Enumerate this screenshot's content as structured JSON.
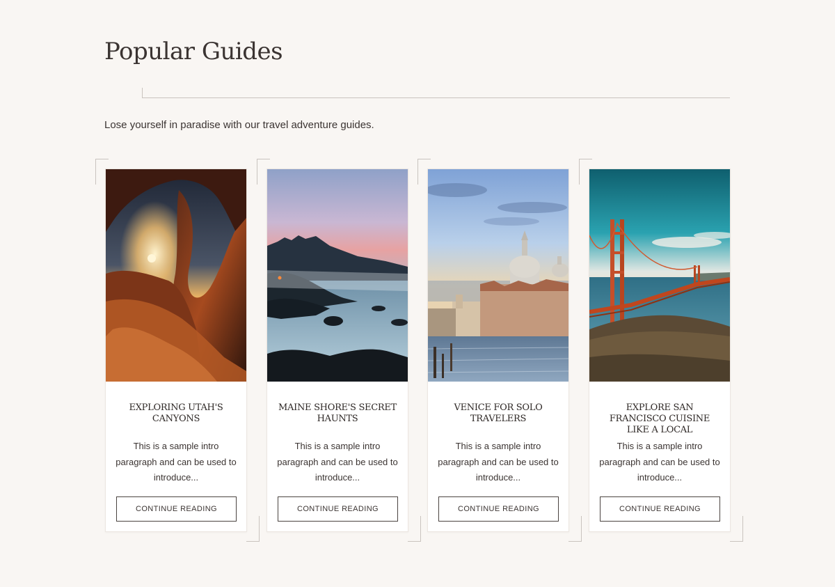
{
  "section": {
    "title": "Popular Guides",
    "intro": "Lose yourself in paradise with our travel adventure guides."
  },
  "guides": [
    {
      "title": "Exploring Utah's Canyons",
      "excerpt": "This is a sample intro paragraph and can be used to introduce...",
      "button_label": "CONTINUE READING",
      "image": "utah-canyon-arch-sunset"
    },
    {
      "title": "Maine Shore's Secret Haunts",
      "excerpt": "This is a sample intro paragraph and can be used to introduce...",
      "button_label": "CONTINUE READING",
      "image": "maine-rocky-shore-dusk"
    },
    {
      "title": "Venice for Solo Travelers",
      "excerpt": "This is a sample intro paragraph and can be used to introduce...",
      "button_label": "CONTINUE READING",
      "image": "venice-grand-canal-basilica"
    },
    {
      "title": "Explore San Francisco Cuisine Like a Local",
      "excerpt": "This is a sample intro paragraph and can be used to introduce...",
      "button_label": "CONTINUE READING",
      "image": "golden-gate-bridge"
    }
  ],
  "colors": {
    "background": "#f9f6f3",
    "card": "#ffffff",
    "text": "#3b3432",
    "rule": "#c9c3be"
  }
}
